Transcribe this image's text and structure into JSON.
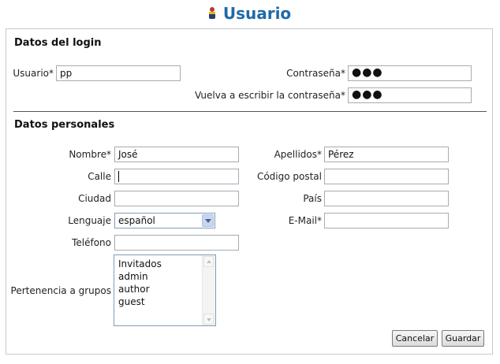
{
  "page": {
    "title": "Usuario",
    "user_icon": "user-icon"
  },
  "login": {
    "section_title": "Datos del login",
    "usuario_label": "Usuario*",
    "usuario_value": "pp",
    "password_label": "Contraseña*",
    "password_value": "●●●",
    "password_repeat_label": "Vuelva a escribir la contraseña*",
    "password_repeat_value": "●●●"
  },
  "personal": {
    "section_title": "Datos personales",
    "nombre_label": "Nombre*",
    "nombre_value": "José",
    "apellidos_label": "Apellidos*",
    "apellidos_value": "Pérez",
    "calle_label": "Calle",
    "calle_value": "",
    "codigo_postal_label": "Código postal",
    "codigo_postal_value": "",
    "ciudad_label": "Ciudad",
    "ciudad_value": "",
    "pais_label": "País",
    "pais_value": "",
    "lenguaje_label": "Lenguaje",
    "lenguaje_value": "español",
    "email_label": "E-Mail*",
    "email_value": "",
    "telefono_label": "Teléfono",
    "telefono_value": "",
    "grupos_label": "Pertenencia a grupos",
    "grupos_options": [
      "Invitados",
      "admin",
      "author",
      "guest"
    ]
  },
  "actions": {
    "cancel_label": "Cancelar",
    "save_label": "Guardar"
  },
  "colors": {
    "title": "#1f6aa8",
    "divider": "#555555",
    "panel_border": "#c9c9c9"
  }
}
